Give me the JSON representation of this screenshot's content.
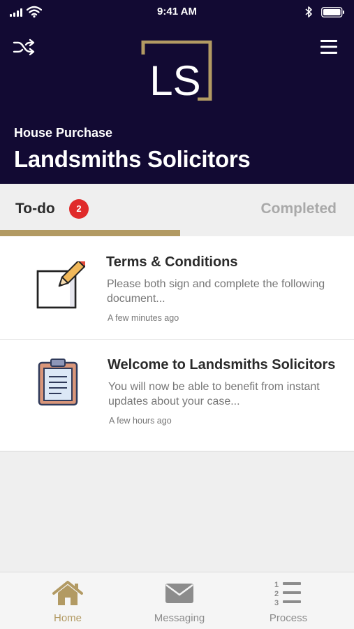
{
  "status_bar": {
    "time": "9:41 AM"
  },
  "header": {
    "shuffle_icon": "shuffle-icon",
    "menu_icon": "hamburger-menu-icon",
    "logo_text": "LS",
    "case_type": "House Purchase",
    "firm_name": "Landsmiths Solicitors",
    "background_color": "#120a33",
    "accent_color": "#b29a63"
  },
  "tabs": {
    "todo_label": "To-do",
    "todo_count": "2",
    "completed_label": "Completed",
    "badge_color": "#e02a2a"
  },
  "tasks": [
    {
      "icon": "edit-document-icon",
      "title": "Terms & Conditions",
      "description": "Please both sign and complete the following document...",
      "time": "A few minutes ago"
    },
    {
      "icon": "clipboard-icon",
      "title": "Welcome to Landsmiths Solicitors",
      "description": "You will now be able to benefit from instant updates about your case...",
      "time": "A few hours ago"
    }
  ],
  "tabbar": {
    "items": [
      {
        "label": "Home",
        "icon": "home-icon",
        "active": true
      },
      {
        "label": "Messaging",
        "icon": "envelope-icon",
        "active": false
      },
      {
        "label": "Process",
        "icon": "numbered-list-icon",
        "active": false
      }
    ]
  }
}
